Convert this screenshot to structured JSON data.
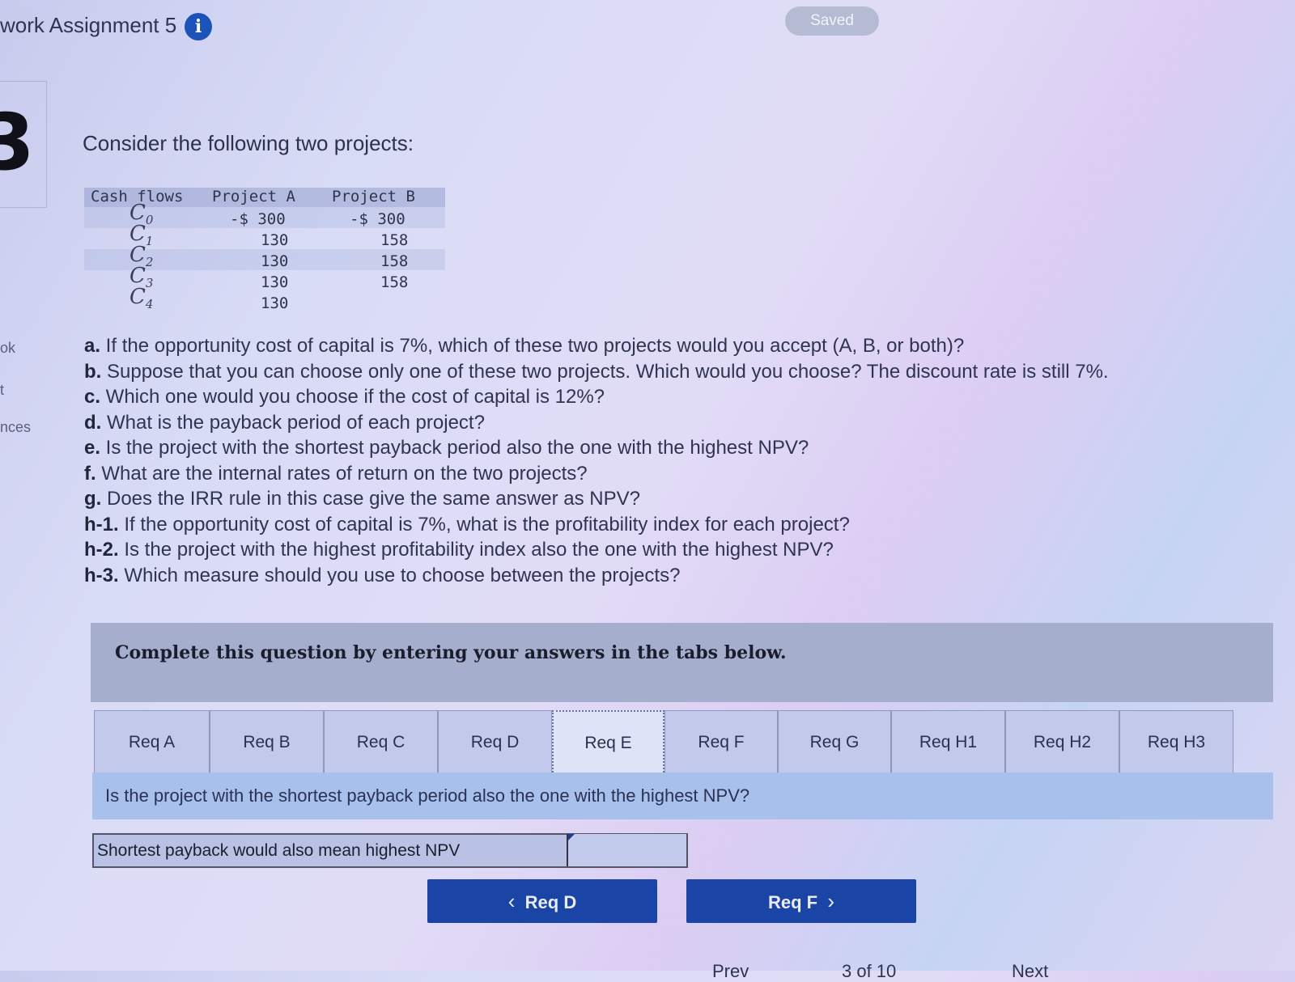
{
  "header": {
    "title": "work Assignment 5",
    "info_icon": "info-icon",
    "saved_label": "Saved"
  },
  "sidebar": {
    "question_number_fragment": "3",
    "fragments": [
      "ok",
      "t",
      "nces"
    ]
  },
  "problem": {
    "intro": "Consider the following two projects:",
    "table": {
      "headers": [
        "Cash flows",
        "Project A",
        "Project B"
      ],
      "rows": [
        {
          "label": "C",
          "sub": "0",
          "a": "-$ 300",
          "b": "-$ 300"
        },
        {
          "label": "C",
          "sub": "1",
          "a": "130",
          "b": "158"
        },
        {
          "label": "C",
          "sub": "2",
          "a": "130",
          "b": "158"
        },
        {
          "label": "C",
          "sub": "3",
          "a": "130",
          "b": "158"
        },
        {
          "label": "C",
          "sub": "4",
          "a": "130",
          "b": ""
        }
      ]
    },
    "questions": [
      {
        "key": "a.",
        "text": " If the opportunity cost of capital is 7%, which of these two projects would you accept (A, B, or both)?"
      },
      {
        "key": "b.",
        "text": " Suppose that you can choose only one of these two projects. Which would you choose? The discount rate is still 7%."
      },
      {
        "key": "c.",
        "text": " Which one would you choose if the cost of capital is 12%?"
      },
      {
        "key": "d.",
        "text": " What is the payback period of each project?"
      },
      {
        "key": "e.",
        "text": " Is the project with the shortest payback period also the one with the highest NPV?"
      },
      {
        "key": "f.",
        "text": " What are the internal rates of return on the two projects?"
      },
      {
        "key": "g.",
        "text": " Does the IRR rule in this case give the same answer as NPV?"
      },
      {
        "key": "h-1.",
        "text": " If the opportunity cost of capital is 7%, what is the profitability index for each project?"
      },
      {
        "key": "h-2.",
        "text": " Is the project with the highest profitability index also the one with the highest NPV?"
      },
      {
        "key": "h-3.",
        "text": " Which measure should you use to choose between the projects?"
      }
    ]
  },
  "answer_panel": {
    "instruction": "Complete this question by entering your answers in the tabs below.",
    "tabs": [
      "Req A",
      "Req B",
      "Req C",
      "Req D",
      "Req E",
      "Req F",
      "Req G",
      "Req H1",
      "Req H2",
      "Req H3"
    ],
    "active_tab": "Req E",
    "tab_question": "Is the project with the shortest payback period also the one with the highest NPV?",
    "row_label": "Shortest payback would also mean highest NPV",
    "row_value": "",
    "prev_button": "Req D",
    "next_button": "Req F"
  },
  "footer": {
    "fragment_left": "Prev",
    "fragment_mid": "3 of 10",
    "fragment_right": "Next"
  }
}
